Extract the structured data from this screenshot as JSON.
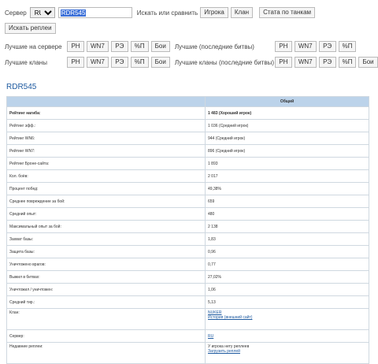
{
  "search": {
    "server_label": "Сервер",
    "server_value": "RU",
    "query": "RDR545",
    "search_or_compare_label": "Искать или сравнить",
    "player_button": "Игрока",
    "clan_button": "Клан",
    "tank_stats_button": "Стата по танкам",
    "replays_button": "Искать реплеи"
  },
  "rankings": {
    "best_on_server_label": "Лучшие на сервере",
    "best_recent_label": "Лучшие (последние битвы)",
    "best_clans_label": "Лучшие кланы",
    "best_clans_recent_label": "Лучшие кланы (последние битвы)",
    "row1_left": [
      "РН",
      "WN7",
      "РЭ",
      "%П",
      "Бои"
    ],
    "row1_right": [
      "РН",
      "WN7",
      "РЭ",
      "%П"
    ],
    "row2_left": [
      "РН",
      "WN7",
      "РЭ",
      "%П",
      "Бои"
    ],
    "row2_right": [
      "РН",
      "WN7",
      "РЭ",
      "%П",
      "Бои"
    ]
  },
  "player": {
    "name": "RDR545",
    "table_header": "Общий",
    "rows": [
      {
        "label": "Рейтинг нагиба:",
        "value": "1 483 (Хороший игрок)",
        "bold": true
      },
      {
        "label": "Рейтинг эфф.:",
        "value": "1 036 (Средний игрок)"
      },
      {
        "label": "Рейтинг WN6:",
        "value": "944 (Средний игрок)"
      },
      {
        "label": "Рейтинг WN7:",
        "value": "896 (Средний игрок)"
      },
      {
        "label": "Рейтинг Броне-сайта:",
        "value": "1 893"
      },
      {
        "label": "Кол. боёв:",
        "value": "2 017"
      },
      {
        "label": "Процент побед:",
        "value": "49,38%"
      },
      {
        "label": "Среднее повреждение за бой:",
        "value": "659"
      },
      {
        "label": "Средний опыт:",
        "value": "480"
      },
      {
        "label": "Максимальный опыт за бой:",
        "value": "2 138"
      },
      {
        "label": "Захват базы:",
        "value": "1,83"
      },
      {
        "label": "Защита базы:",
        "value": "0,96"
      },
      {
        "label": "Уничтожено врагов:",
        "value": "0,77"
      },
      {
        "label": "Выжил в битвах:",
        "value": "27,02%"
      },
      {
        "label": "Уничтожил / уничтожен:",
        "value": "1,06"
      },
      {
        "label": "Средний тир.:",
        "value": "5,13"
      }
    ],
    "clan_label": "Клан:",
    "clan_link": "NUKER",
    "clan_history_link": "История (внешний сайт)",
    "server_label": "Сервер:",
    "server_link": "RU",
    "replays_label": "Недавние реплеи:",
    "replays_none": "У игрока нету реплеев",
    "upload_replay_link": "Загрузить реплей"
  }
}
